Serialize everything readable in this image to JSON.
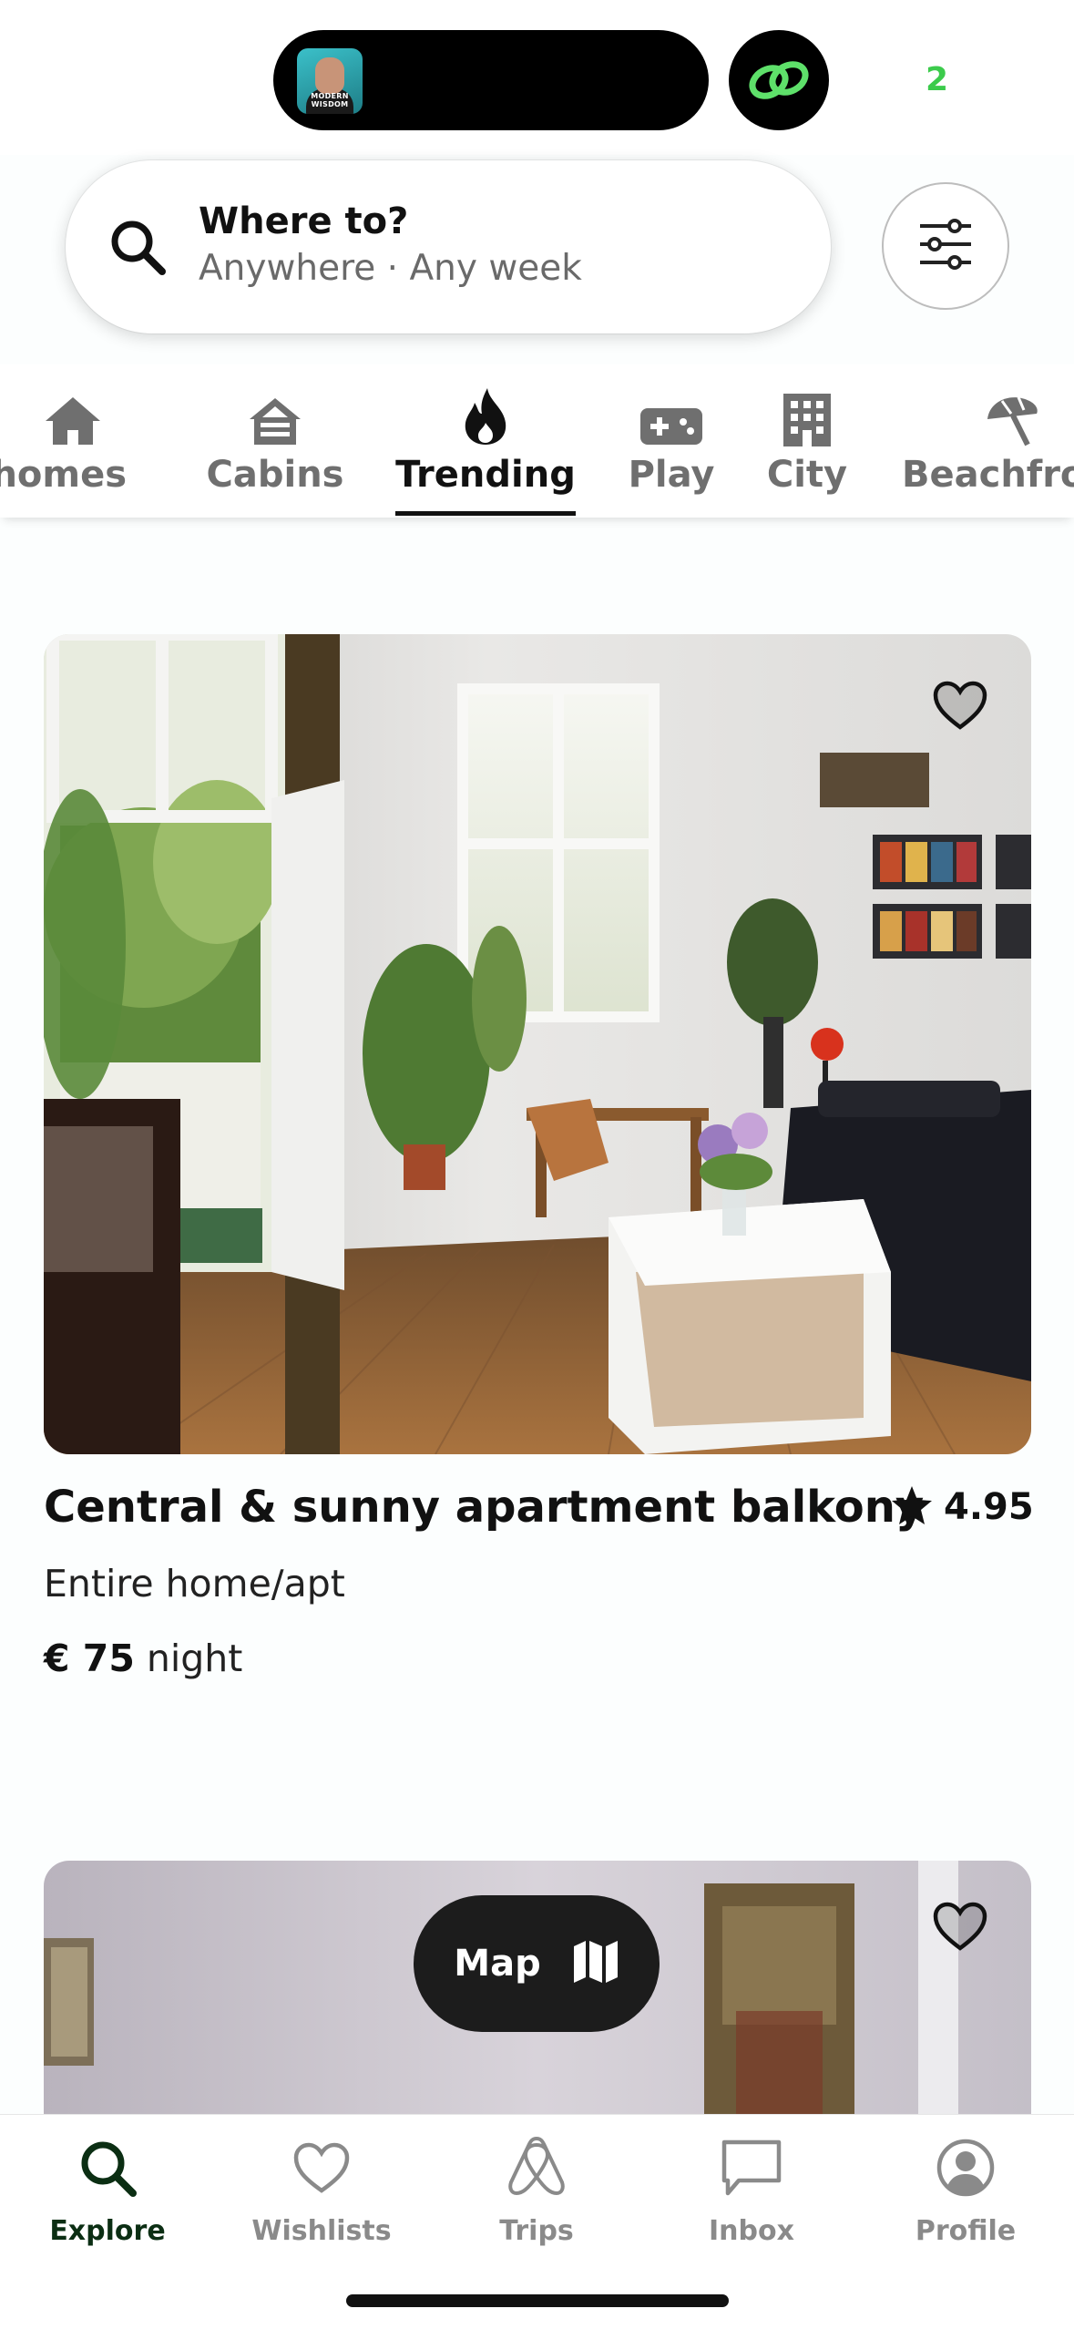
{
  "status_bar": {
    "podcast_caption": "MODERN WISDOM",
    "badge_text": "2"
  },
  "search": {
    "title": "Where to?",
    "subtitle": "Anywhere · Any week"
  },
  "categories": [
    {
      "label": "Tiny homes",
      "icon": "house-icon",
      "active": false
    },
    {
      "label": "Cabins",
      "icon": "cabin-icon",
      "active": false
    },
    {
      "label": "Trending",
      "icon": "fire-icon",
      "active": true
    },
    {
      "label": "Play",
      "icon": "gamepad-icon",
      "active": false
    },
    {
      "label": "City",
      "icon": "building-icon",
      "active": false
    },
    {
      "label": "Beachfront",
      "icon": "beach-umbrella-icon",
      "active": false
    }
  ],
  "listing": {
    "title": "Central & sunny apartment balkony",
    "rating": "4.95",
    "type": "Entire home/apt",
    "price": "€ 75",
    "price_unit": "night"
  },
  "map_button": {
    "label": "Map"
  },
  "tabs": [
    {
      "label": "Explore",
      "icon": "search-icon",
      "active": true
    },
    {
      "label": "Wishlists",
      "icon": "heart-icon",
      "active": false
    },
    {
      "label": "Trips",
      "icon": "airbnb-logo-icon",
      "active": false
    },
    {
      "label": "Inbox",
      "icon": "message-icon",
      "active": false
    },
    {
      "label": "Profile",
      "icon": "user-icon",
      "active": false
    }
  ],
  "colors": {
    "accent_active": "#0b2e13",
    "inactive": "#8a8a8a",
    "map_button_bg": "#1c1c1c",
    "badge_green": "#3ccb4c"
  }
}
